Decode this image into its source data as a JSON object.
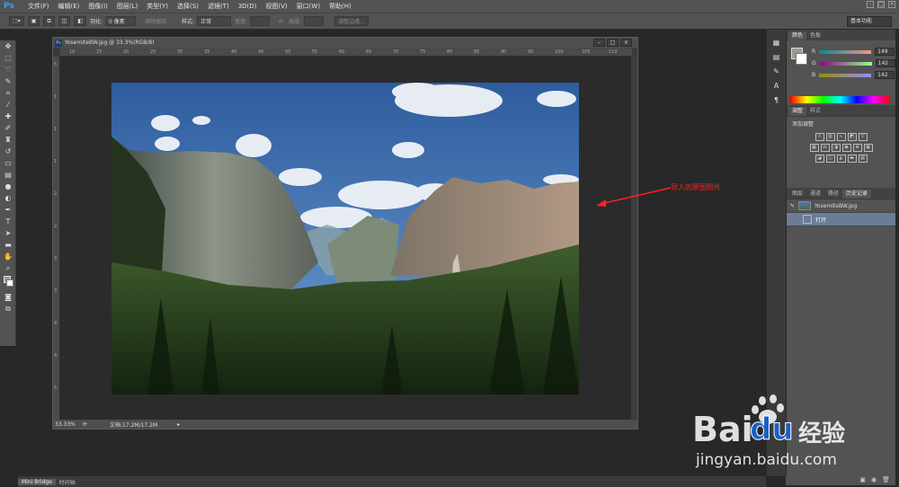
{
  "app": {
    "logo": "Ps"
  },
  "menu": [
    "文件(F)",
    "编辑(E)",
    "图像(I)",
    "图层(L)",
    "类型(Y)",
    "选择(S)",
    "滤镜(T)",
    "3D(D)",
    "视图(V)",
    "窗口(W)",
    "帮助(H)"
  ],
  "options": {
    "feather_label": "羽化:",
    "feather_value": "0 像素",
    "antialias_label": "消除锯齿",
    "style_label": "样式:",
    "style_value": "正常",
    "width_label": "宽度:",
    "height_label": "高度:",
    "refine_edge": "调整边缘...",
    "workspace": "基本功能"
  },
  "document": {
    "title": "YosemiteBW.jpg @ 33.3%(RGB/8)",
    "ruler_top": [
      "10",
      "15",
      "20",
      "25",
      "30",
      "35",
      "40",
      "45",
      "50",
      "55",
      "60",
      "65",
      "70",
      "75",
      "80",
      "85",
      "90",
      "95",
      "100",
      "105",
      "110"
    ],
    "ruler_left": [
      "5",
      "1",
      "1",
      "1",
      "2",
      "2",
      "3",
      "3",
      "4",
      "4",
      "5"
    ],
    "zoom": "33.33%",
    "doc_info": "文档:17.2M/17.2M"
  },
  "annotation": {
    "text": "导入的原图照片",
    "color": "#ff2020"
  },
  "panels": {
    "color_tabs": [
      "颜色",
      "色板"
    ],
    "rgb": [
      {
        "label": "R",
        "value": "149"
      },
      {
        "label": "G",
        "value": "142"
      },
      {
        "label": "B",
        "value": "142"
      }
    ],
    "adjust_tabs": [
      "调整",
      "样式"
    ],
    "adjust_title": "添加调整",
    "history_tabs": [
      "图层",
      "通道",
      "路径",
      "历史记录"
    ],
    "history_items": [
      {
        "label": "YosemiteBW.jpg"
      },
      {
        "label": "打开"
      }
    ]
  },
  "bottom_tabs": [
    "Mini Bridge",
    "时间轴"
  ],
  "watermark": {
    "brand": "Bai",
    "brand2": "经验",
    "url": "jingyan.baidu.com"
  },
  "colors": {
    "accent": "#2fa3ff",
    "selected": "#6b7c96"
  }
}
